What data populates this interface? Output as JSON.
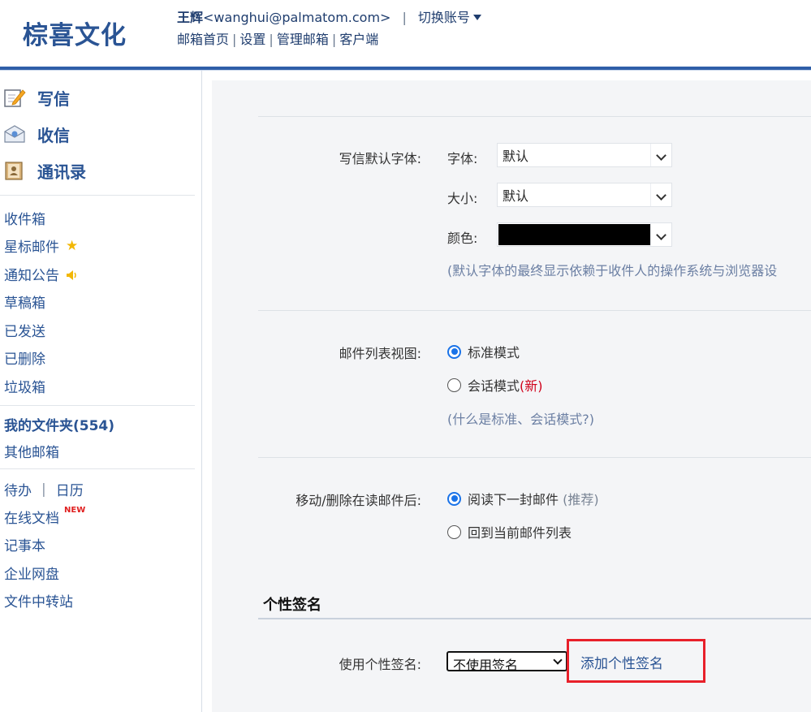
{
  "header": {
    "logo": "棕喜文化",
    "user_name": "王辉",
    "user_email": "<wanghui@palmatom.com>",
    "separator": "|",
    "switch_account": "切换账号",
    "links": [
      "邮箱首页",
      "设置",
      "管理邮箱",
      "客户端"
    ]
  },
  "sidebar": {
    "quick": [
      {
        "label": "写信",
        "icon": "compose-icon"
      },
      {
        "label": "收信",
        "icon": "inbox-receive-icon"
      },
      {
        "label": "通讯录",
        "icon": "contacts-icon"
      }
    ],
    "folders": {
      "inbox": "收件箱",
      "starred": "星标邮件",
      "notice": "通知公告",
      "drafts": "草稿箱",
      "sent": "已发送",
      "deleted": "已删除",
      "spam": "垃圾箱"
    },
    "my_folders": "我的文件夹(554)",
    "other_mail": "其他邮箱",
    "todo": "待办",
    "todo_sep": "|",
    "calendar": "日历",
    "online_docs": "在线文档",
    "new_badge": "NEW",
    "notes": "记事本",
    "netdisk": "企业网盘",
    "transfer": "文件中转站",
    "accent": "#2a5494"
  },
  "settings": {
    "font": {
      "label": "写信默认字体:",
      "family_label": "字体:",
      "family_value": "默认",
      "size_label": "大小:",
      "size_value": "默认",
      "color_label": "颜色:",
      "color_value": "#000000",
      "hint": "(默认字体的最终显示依赖于收件人的操作系统与浏览器设"
    },
    "list_view": {
      "label": "邮件列表视图:",
      "option_standard": "标准模式",
      "option_conversation": "会话模式",
      "new_tag": "(新)",
      "help": "(什么是标准、会话模式?)",
      "selected": "standard"
    },
    "after_move": {
      "label": "移动/删除在读邮件后:",
      "option_next": "阅读下一封邮件",
      "recommended": "(推荐)",
      "option_back": "回到当前邮件列表",
      "selected": "next"
    },
    "signature": {
      "section_title": "个性签名",
      "label": "使用个性签名:",
      "select_value": "不使用签名",
      "add_link": "添加个性签名"
    }
  }
}
